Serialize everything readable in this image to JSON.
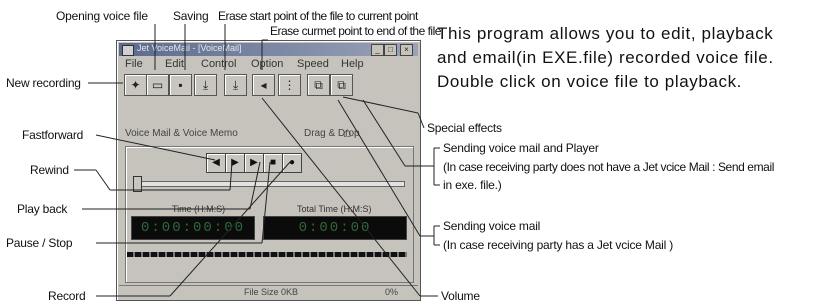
{
  "labels": {
    "opening_voice_file": "Opening voice file",
    "saving": "Saving",
    "erase_start": "Erase start point of the file to current point",
    "erase_end": "Erase curmet point to end of the file",
    "new_recording": "New recording",
    "fastforward": "Fastforward",
    "rewind": "Rewind",
    "play_back": "Play back",
    "pause_stop": "Pause / Stop",
    "record": "Record",
    "special_effects": "Special effects",
    "send_player_1": "Sending voice mail and Player",
    "send_player_2": "(In case receiving party does not have a Jet vcice Mail : Send email",
    "send_player_3": "in exe. file.)",
    "send_mail_1": "Sending voice mail",
    "send_mail_2": "(In case receiving party has a Jet vcice Mail )",
    "volume": "Volume"
  },
  "description": {
    "line1": "This program allows you to edit, playback",
    "line2": "and email(in EXE.file) recorded voice file.",
    "line3": "Double click on voice file to playback."
  },
  "window": {
    "title": "Jet VoiceMail - [VoiceMail]",
    "menu": [
      "File",
      "Edit",
      "Control",
      "Option",
      "Speed",
      "Help"
    ],
    "voice_mail_label": "Voice Mail & Voice Memo",
    "drag_drop_label": "Drag & Drop",
    "time_label": "Time (H:M:S)",
    "total_time_label": "Total Time (H:M:S)",
    "time_value": "0:00:00:00",
    "total_time_value": "0:00:00",
    "status_file_size": "File Size 0KB",
    "status_right": "0%"
  },
  "colors": {
    "window_bg": "#c6c3bd",
    "titlebar": "#5b6a8e",
    "display_bg": "#0b0b0b"
  }
}
